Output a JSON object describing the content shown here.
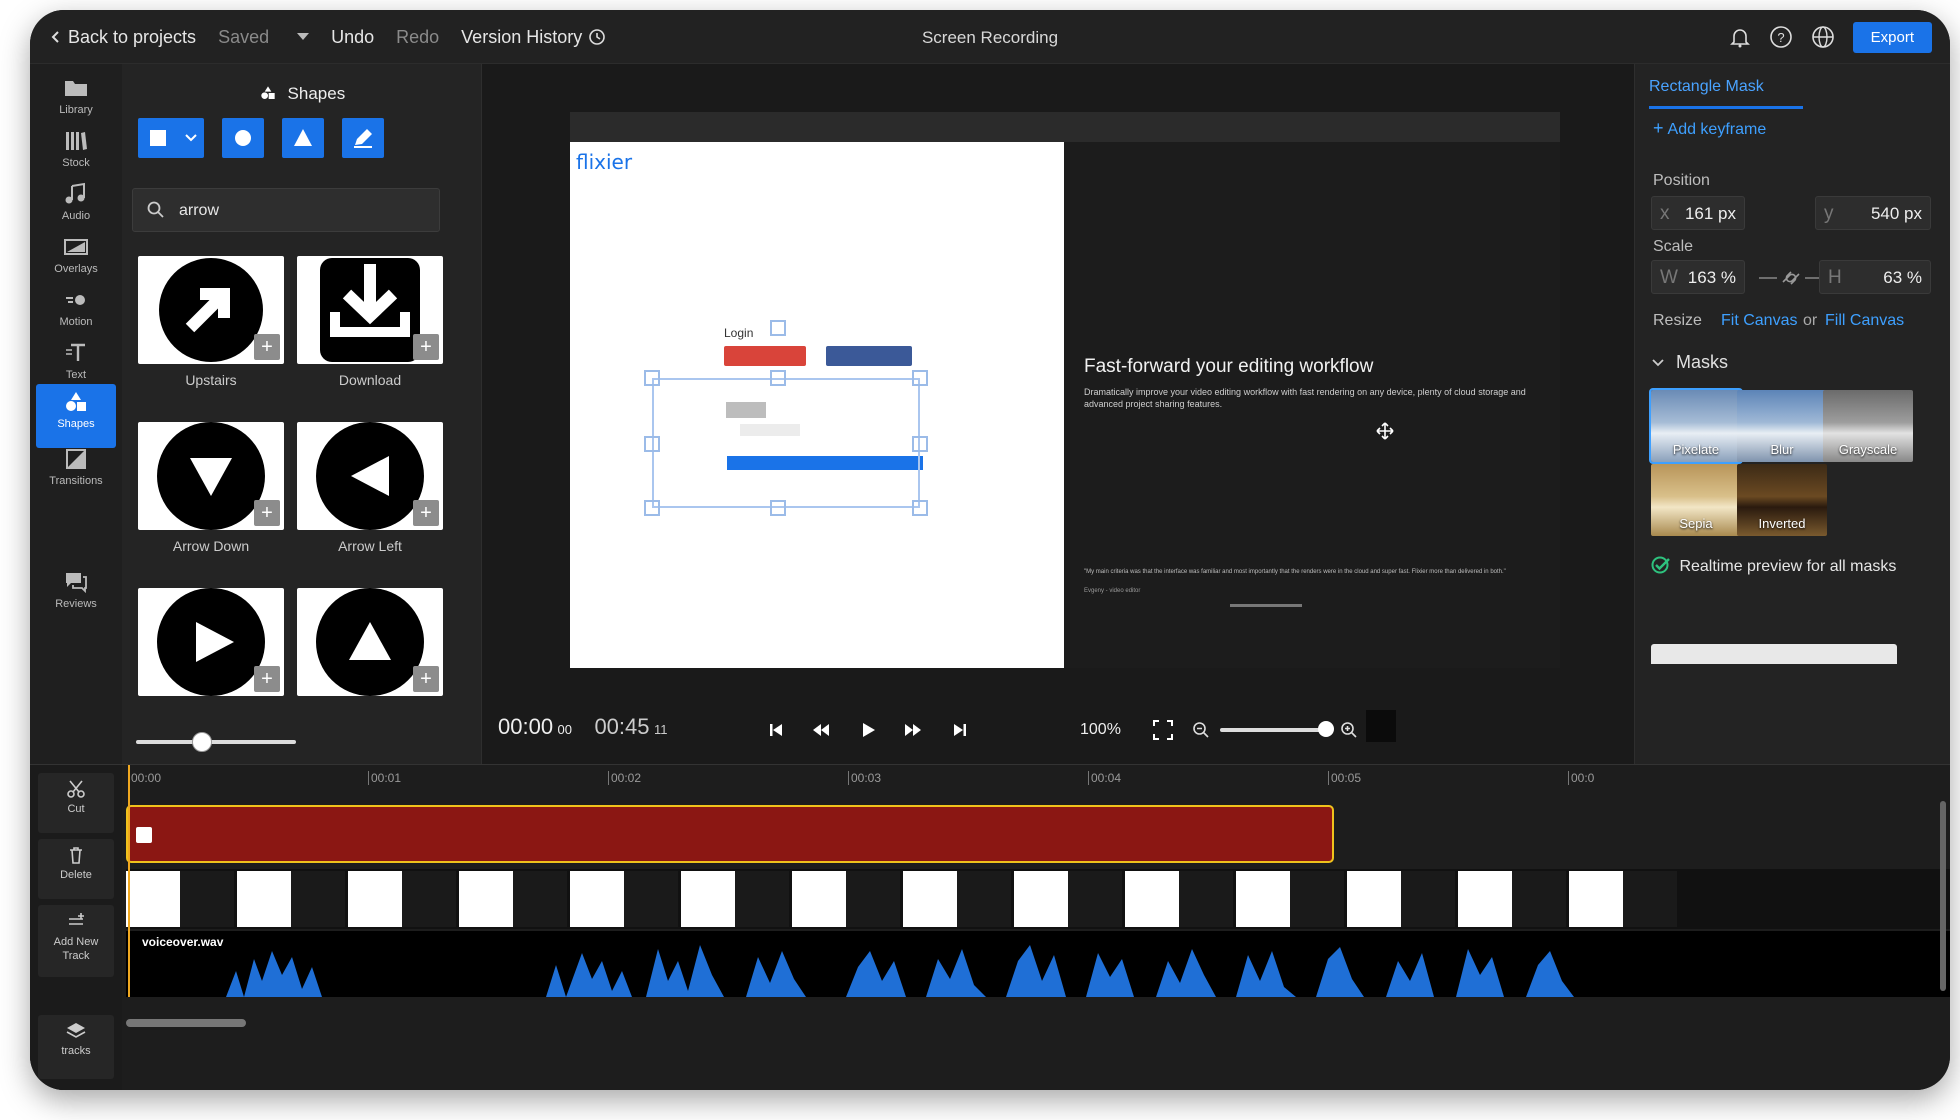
{
  "topbar": {
    "back_label": "Back to projects",
    "saved_label": "Saved",
    "undo_label": "Undo",
    "redo_label": "Redo",
    "version_history_label": "Version History",
    "title": "Screen Recording",
    "export_label": "Export"
  },
  "rail": {
    "items": [
      {
        "label": "Library",
        "icon": "folder-icon"
      },
      {
        "label": "Stock",
        "icon": "stock-icon"
      },
      {
        "label": "Audio",
        "icon": "music-icon"
      },
      {
        "label": "Overlays",
        "icon": "overlay-icon"
      },
      {
        "label": "Motion",
        "icon": "motion-icon"
      },
      {
        "label": "Text",
        "icon": "text-icon"
      },
      {
        "label": "Shapes",
        "icon": "shapes-icon"
      },
      {
        "label": "Transitions",
        "icon": "transitions-icon"
      },
      {
        "label": "Reviews",
        "icon": "reviews-icon"
      }
    ],
    "active": "Shapes"
  },
  "shapes_panel": {
    "title": "Shapes",
    "search_value": "arrow",
    "items": [
      {
        "label": "Upstairs",
        "icon": "arrow-upright-icon"
      },
      {
        "label": "Download",
        "icon": "download-icon"
      },
      {
        "label": "Arrow Down",
        "icon": "arrow-down-icon"
      },
      {
        "label": "Arrow Left",
        "icon": "arrow-left-icon"
      },
      {
        "label": "",
        "icon": "play-icon"
      },
      {
        "label": "",
        "icon": "arrow-up-icon"
      }
    ],
    "slider_value": 0.35
  },
  "preview": {
    "brand": "flixier",
    "login_label": "Login",
    "heading": "Fast-forward your editing workflow",
    "body": "Dramatically improve your video editing workflow with fast rendering on any device, plenty of cloud storage and advanced project sharing features.",
    "quote": "\"My main criteria was that the interface was familiar and most importantly that the renders were in the cloud and super fast. Flixier more than delivered in both.\"",
    "quote_author": "Evgeny - video editor"
  },
  "playback": {
    "current_time": "00:00",
    "current_frames": "00",
    "total_time": "00:45",
    "total_frames": "11",
    "zoom": "100%",
    "zoom_slider": 0.95
  },
  "properties": {
    "tab": "Rectangle Mask",
    "add_keyframe": "Add keyframe",
    "position_label": "Position",
    "x_prefix": "x",
    "x_value": "161 px",
    "y_prefix": "y",
    "y_value": "540 px",
    "scale_label": "Scale",
    "w_prefix": "W",
    "w_value": "163 %",
    "h_prefix": "H",
    "h_value": "63 %",
    "resize_label": "Resize",
    "fit_canvas": "Fit Canvas",
    "or_label": "or",
    "fill_canvas": "Fill Canvas",
    "masks_label": "Masks",
    "masks": [
      {
        "label": "Pixelate",
        "selected": true
      },
      {
        "label": "Blur",
        "selected": false
      },
      {
        "label": "Grayscale",
        "selected": false
      },
      {
        "label": "Sepia",
        "selected": false
      },
      {
        "label": "Inverted",
        "selected": false
      }
    ],
    "realtime_label": "Realtime preview for all masks"
  },
  "timeline": {
    "tools": [
      {
        "label": "Cut",
        "icon": "scissors-icon"
      },
      {
        "label": "Delete",
        "icon": "trash-icon"
      },
      {
        "label": "Add New Track",
        "icon": "add-track-icon"
      },
      {
        "label": "tracks",
        "icon": "layers-icon"
      }
    ],
    "ticks": [
      "00:00",
      "00:01",
      "00:02",
      "00:03",
      "00:04",
      "00:05",
      "00:0"
    ],
    "audio_clip": "voiceover.wav",
    "accent": "#f0c21c",
    "clip_color": "#8b1713"
  }
}
